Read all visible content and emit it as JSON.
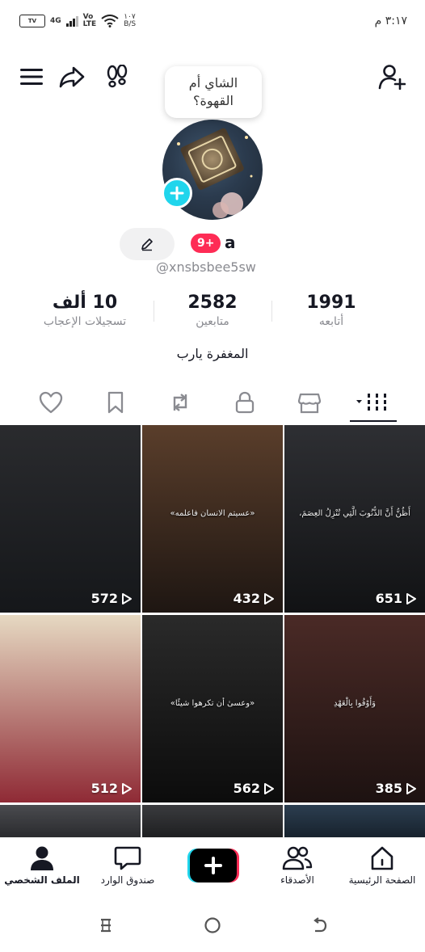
{
  "status_bar": {
    "left_badge": "TV",
    "network": "4G",
    "volte": "Vo\nLTE",
    "speed": "١٠٧\nB/S",
    "time": "٣:١٧ م"
  },
  "top_bar": {
    "menu_icon": "hamburger-icon",
    "share_icon": "share-arrow-icon",
    "footprints_icon": "footprints-icon",
    "add_friend_icon": "add-user-icon"
  },
  "profile": {
    "note_bubble": "الشاي أم القهوة؟",
    "display_name": "a",
    "notification_badge": "9+",
    "username": "@xnsbsbee5sw",
    "bio": "المغفرة يارب"
  },
  "stats": [
    {
      "value": "1991",
      "label": "أتابعه"
    },
    {
      "value": "2582",
      "label": "متابعين"
    },
    {
      "value": "10 ألف",
      "label": "تسجيلات الإعجاب"
    }
  ],
  "tabs": [
    {
      "name": "liked",
      "icon": "heart-icon"
    },
    {
      "name": "favorites",
      "icon": "bookmark-icon"
    },
    {
      "name": "reposts",
      "icon": "repost-icon"
    },
    {
      "name": "private",
      "icon": "lock-icon"
    },
    {
      "name": "shop",
      "icon": "shop-icon"
    },
    {
      "name": "videos",
      "icon": "grid-icon",
      "active": true
    }
  ],
  "videos": [
    {
      "views": "572",
      "caption": "",
      "colors": [
        "#2a2b2e",
        "#15171a"
      ]
    },
    {
      "views": "432",
      "caption": "«عسيتم الانسان فاعلمه»",
      "colors": [
        "#5a3e2b",
        "#1e1612"
      ]
    },
    {
      "views": "651",
      "caption": "أَظُنُّ أَنَّ الذُّنُوبَ الَّتِي تُنْزِلُ العِصَمَ،",
      "colors": [
        "#2e2f33",
        "#111214"
      ]
    },
    {
      "views": "512",
      "caption": "",
      "colors": [
        "#e6d9c2",
        "#8f2a35"
      ]
    },
    {
      "views": "562",
      "caption": "«وعسىٰ أن تكرهوا شيئًا»",
      "colors": [
        "#2a2a2a",
        "#0c0c0c"
      ]
    },
    {
      "views": "385",
      "caption": "وَأَوْفُوا بِالْعَهْدِ",
      "colors": [
        "#4a2a26",
        "#1d1211"
      ]
    }
  ],
  "bottom_nav": [
    {
      "label": "الصفحة الرئيسية",
      "icon": "home-icon"
    },
    {
      "label": "الأصدقاء",
      "icon": "friends-icon"
    },
    {
      "label": "",
      "icon": "create-plus-icon"
    },
    {
      "label": "صندوق الوارد",
      "icon": "inbox-icon"
    },
    {
      "label": "الملف الشخصي",
      "icon": "profile-icon"
    }
  ],
  "colors": {
    "accent_pink": "#fe2c55",
    "accent_cyan": "#20d5ec",
    "text_primary": "#161823",
    "text_secondary": "#8a8b91"
  }
}
